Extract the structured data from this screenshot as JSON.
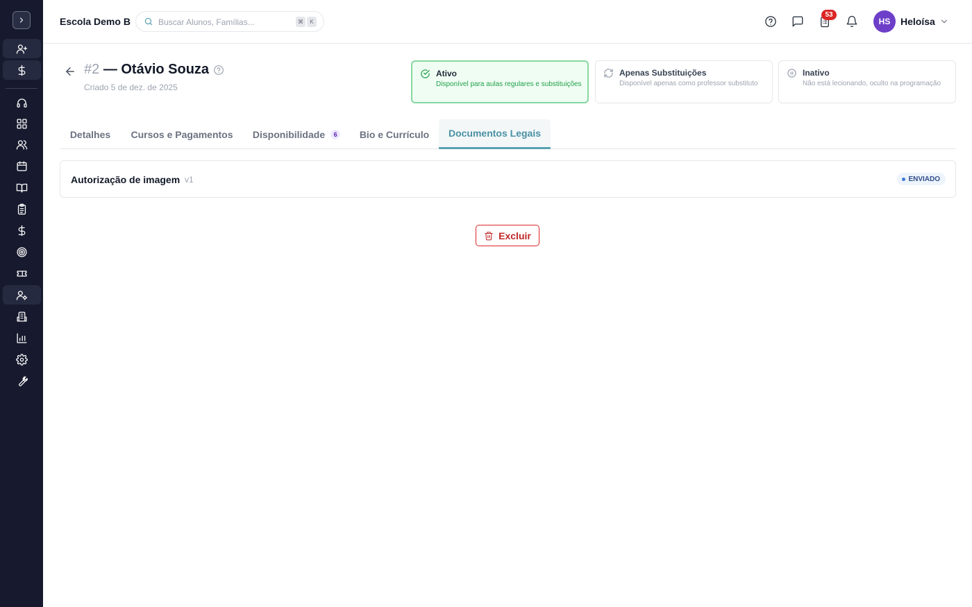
{
  "header": {
    "school_name": "Escola Demo B",
    "search_placeholder": "Buscar Alunos, Famílias...",
    "shortcut_keys": [
      "⌘",
      "K"
    ],
    "notification_count": "53",
    "user_initials": "HS",
    "user_name": "Heloísa"
  },
  "sidebar": {
    "icons": [
      "chevron-right-icon",
      "user-plus-icon",
      "dollar-icon",
      "headset-icon",
      "grid-icon",
      "users-icon",
      "calendar-icon",
      "book-open-icon",
      "clipboard-icon",
      "dollar-icon",
      "target-icon",
      "ticket-icon",
      "user-cog-icon",
      "building-icon",
      "bar-chart-icon",
      "settings-icon",
      "wrench-icon"
    ]
  },
  "teacher": {
    "number": "#2",
    "name": "— Otávio Souza",
    "created": "Criado 5 de dez. de 2025"
  },
  "status_options": [
    {
      "title": "Ativo",
      "description": "Disponível para aulas regulares e substituições",
      "selected": true
    },
    {
      "title": "Apenas Substituições",
      "description": "Disponível apenas como professor substituto",
      "selected": false
    },
    {
      "title": "Inativo",
      "description": "Não está lecionando, oculto na programação",
      "selected": false
    }
  ],
  "tabs": [
    {
      "label": "Detalhes"
    },
    {
      "label": "Cursos e Pagamentos"
    },
    {
      "label": "Disponibilidade",
      "count": "6"
    },
    {
      "label": "Bio e Currículo"
    },
    {
      "label": "Documentos Legais",
      "active": true
    }
  ],
  "documents": [
    {
      "name": "Autorização de imagem",
      "version": "v1",
      "status": "ENVIADO"
    }
  ],
  "actions": {
    "delete_label": "Excluir"
  },
  "colors": {
    "sidebar_bg": "#171a2e",
    "active_status_border": "#86d7a0",
    "active_tab": "#4a90a4",
    "danger": "#dc2626",
    "avatar": "#6d3fc9"
  }
}
